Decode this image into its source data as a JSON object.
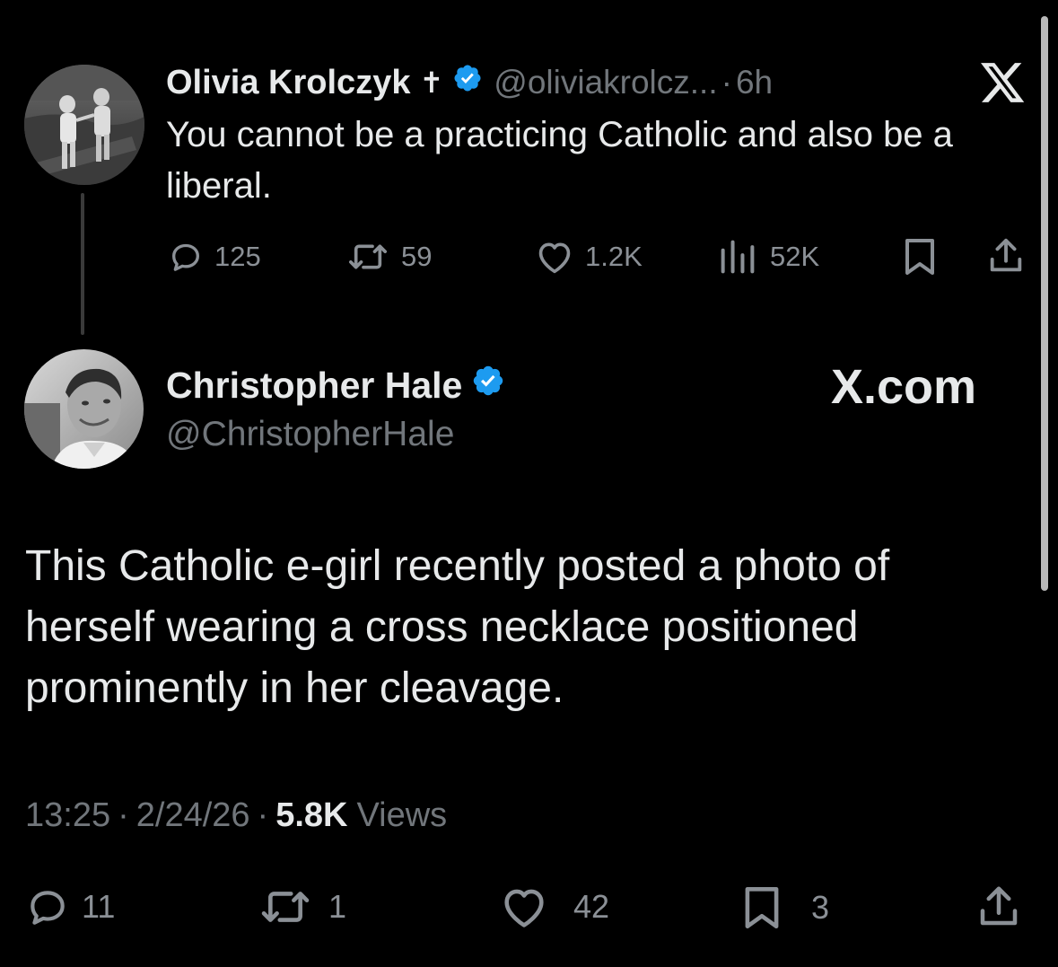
{
  "quoted_tweet": {
    "author_name": "Olivia Krolczyk",
    "name_symbol": "✝",
    "handle": "@oliviakrolcz...",
    "separator": "·",
    "time": "6h",
    "text": "You cannot be a practicing Catholic and also be a liberal.",
    "stats": {
      "replies": "125",
      "reposts": "59",
      "likes": "1.2K",
      "views": "52K"
    }
  },
  "main_tweet": {
    "author_name": "Christopher Hale",
    "handle": "@ChristopherHale",
    "text": "This Catholic e-girl recently posted a photo of herself wearing a cross necklace positioned prominently in her cleavage.",
    "timestamp": "13:25",
    "date": "2/24/26",
    "views_count": "5.8K",
    "views_label": "Views",
    "separator": "·",
    "stats": {
      "replies": "11",
      "reposts": "1",
      "likes": "42",
      "bookmarks": "3"
    }
  },
  "branding": {
    "x_logo": "X",
    "watermark": "X.com"
  },
  "icons": {
    "verified": "verified-badge-icon",
    "reply": "reply-icon",
    "repost": "repost-icon",
    "like": "like-icon",
    "views": "views-icon",
    "bookmark": "bookmark-icon",
    "share": "share-icon"
  },
  "colors": {
    "background": "#000000",
    "text": "#e7e9ea",
    "muted": "#71767b",
    "verified_blue": "#1d9bf0"
  }
}
